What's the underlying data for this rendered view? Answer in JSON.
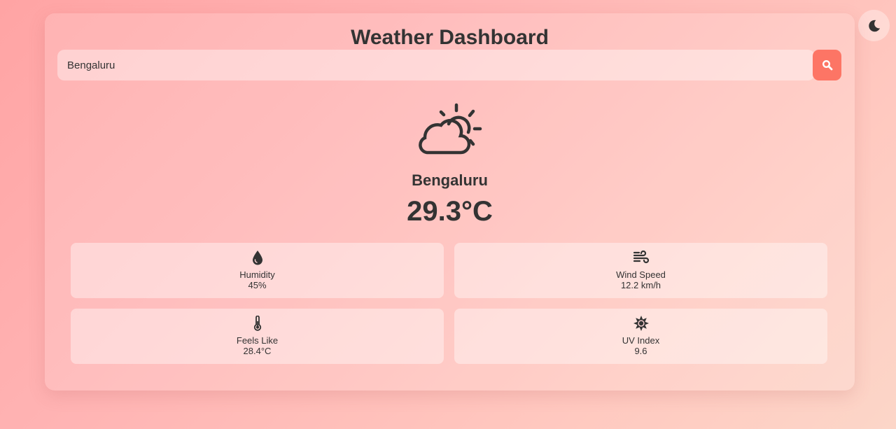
{
  "header": {
    "title": "Weather Dashboard"
  },
  "search": {
    "value": "Bengaluru",
    "button_icon": "search-icon"
  },
  "theme_toggle": {
    "icon": "moon-icon"
  },
  "current": {
    "icon": "partly-cloudy-icon",
    "city": "Bengaluru",
    "temperature": "29.3°C"
  },
  "details": [
    {
      "icon": "droplet-icon",
      "label": "Humidity",
      "value": "45%"
    },
    {
      "icon": "wind-icon",
      "label": "Wind Speed",
      "value": "12.2 km/h"
    },
    {
      "icon": "thermometer-icon",
      "label": "Feels Like",
      "value": "28.4°C"
    },
    {
      "icon": "sun-icon",
      "label": "UV Index",
      "value": "9.6"
    }
  ],
  "colors": {
    "accent": "#fd7565",
    "text": "#333333"
  }
}
